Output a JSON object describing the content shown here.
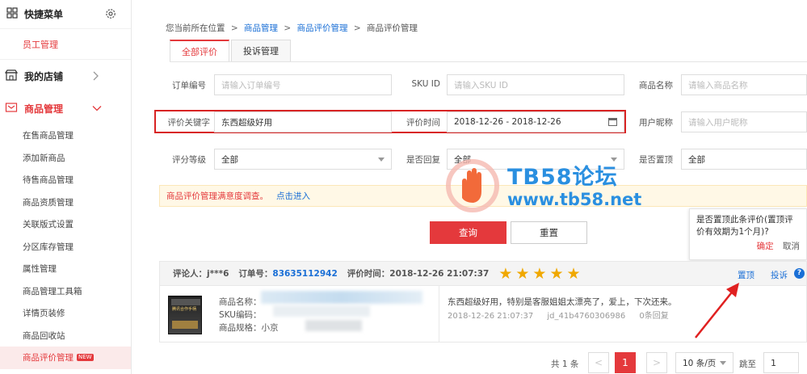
{
  "sidebar": {
    "quick_menu": "快捷菜单",
    "quick_sub": "员工管理",
    "my_shop": "我的店铺",
    "goods_mgmt": "商品管理",
    "items": [
      {
        "label": "在售商品管理"
      },
      {
        "label": "添加新商品"
      },
      {
        "label": "待售商品管理"
      },
      {
        "label": "商品资质管理"
      },
      {
        "label": "关联版式设置"
      },
      {
        "label": "分区库存管理"
      },
      {
        "label": "属性管理"
      },
      {
        "label": "商品管理工具箱"
      },
      {
        "label": "详情页装修"
      },
      {
        "label": "商品回收站"
      },
      {
        "label": "商品评价管理",
        "badge": "NEW"
      }
    ]
  },
  "breadcrumb": {
    "prefix": "您当前所在位置",
    "sep": ">",
    "level1": "商品管理",
    "level2": "商品评价管理",
    "current": "商品评价管理"
  },
  "tabs": {
    "all": "全部评价",
    "complaint": "投诉管理"
  },
  "filters": {
    "order_no_label": "订单编号",
    "order_no_placeholder": "请输入订单编号",
    "sku_label": "SKU ID",
    "sku_placeholder": "请输入SKU ID",
    "product_name_label": "商品名称",
    "product_name_placeholder": "请输入商品名称",
    "keyword_label": "评价关键字",
    "keyword_value": "东西超级好用",
    "time_label": "评价时间",
    "time_value": "2018-12-26 - 2018-12-26",
    "nickname_label": "用户昵称",
    "nickname_placeholder": "请输入用户昵称",
    "score_label": "评分等级",
    "score_value": "全部",
    "replied_label": "是否回复",
    "replied_value": "全部",
    "pinned_label": "是否置顶",
    "pinned_value": "全部"
  },
  "notice": {
    "text": "商品评价管理满意度调查。",
    "link": "点击进入"
  },
  "buttons": {
    "query": "查询",
    "reset": "重置"
  },
  "popover": {
    "text": "是否置顶此条评价(置顶评价有效期为1个月)?",
    "ok": "确定",
    "cancel": "取消"
  },
  "review": {
    "reviewer": "评论人：j***6",
    "order_label": "订单号：",
    "order_no": "83635112942",
    "time": "评价时间：2018-12-26 21:07:37",
    "stars": 5,
    "pin": "置顶",
    "complain": "投诉",
    "help": "?",
    "product_name": "商品名称：",
    "sku_code": "SKU编码：",
    "spec": "商品规格：小京",
    "thumb_tag": "腾讯合作手柄",
    "content": "东西超级好用，特别是客服姐姐太漂亮了，爱上，下次还来。",
    "review_time": "2018-12-26 21:07:37",
    "user_id": "jd_41b4760306986",
    "replies": "0条回复"
  },
  "pager": {
    "total": "共 1 条",
    "prev": "<",
    "page": "1",
    "next": ">",
    "size": "10 条/页",
    "jump_label": "跳至",
    "jump_value": "1"
  },
  "watermark": {
    "line1": "TB58论坛",
    "line2": "www.tb58.net"
  },
  "colors": {
    "accent": "#e4393c",
    "link": "#1a6fd6",
    "star": "#f0a800",
    "highlight_border": "#d82323",
    "watermark": "#2a8fe0"
  }
}
